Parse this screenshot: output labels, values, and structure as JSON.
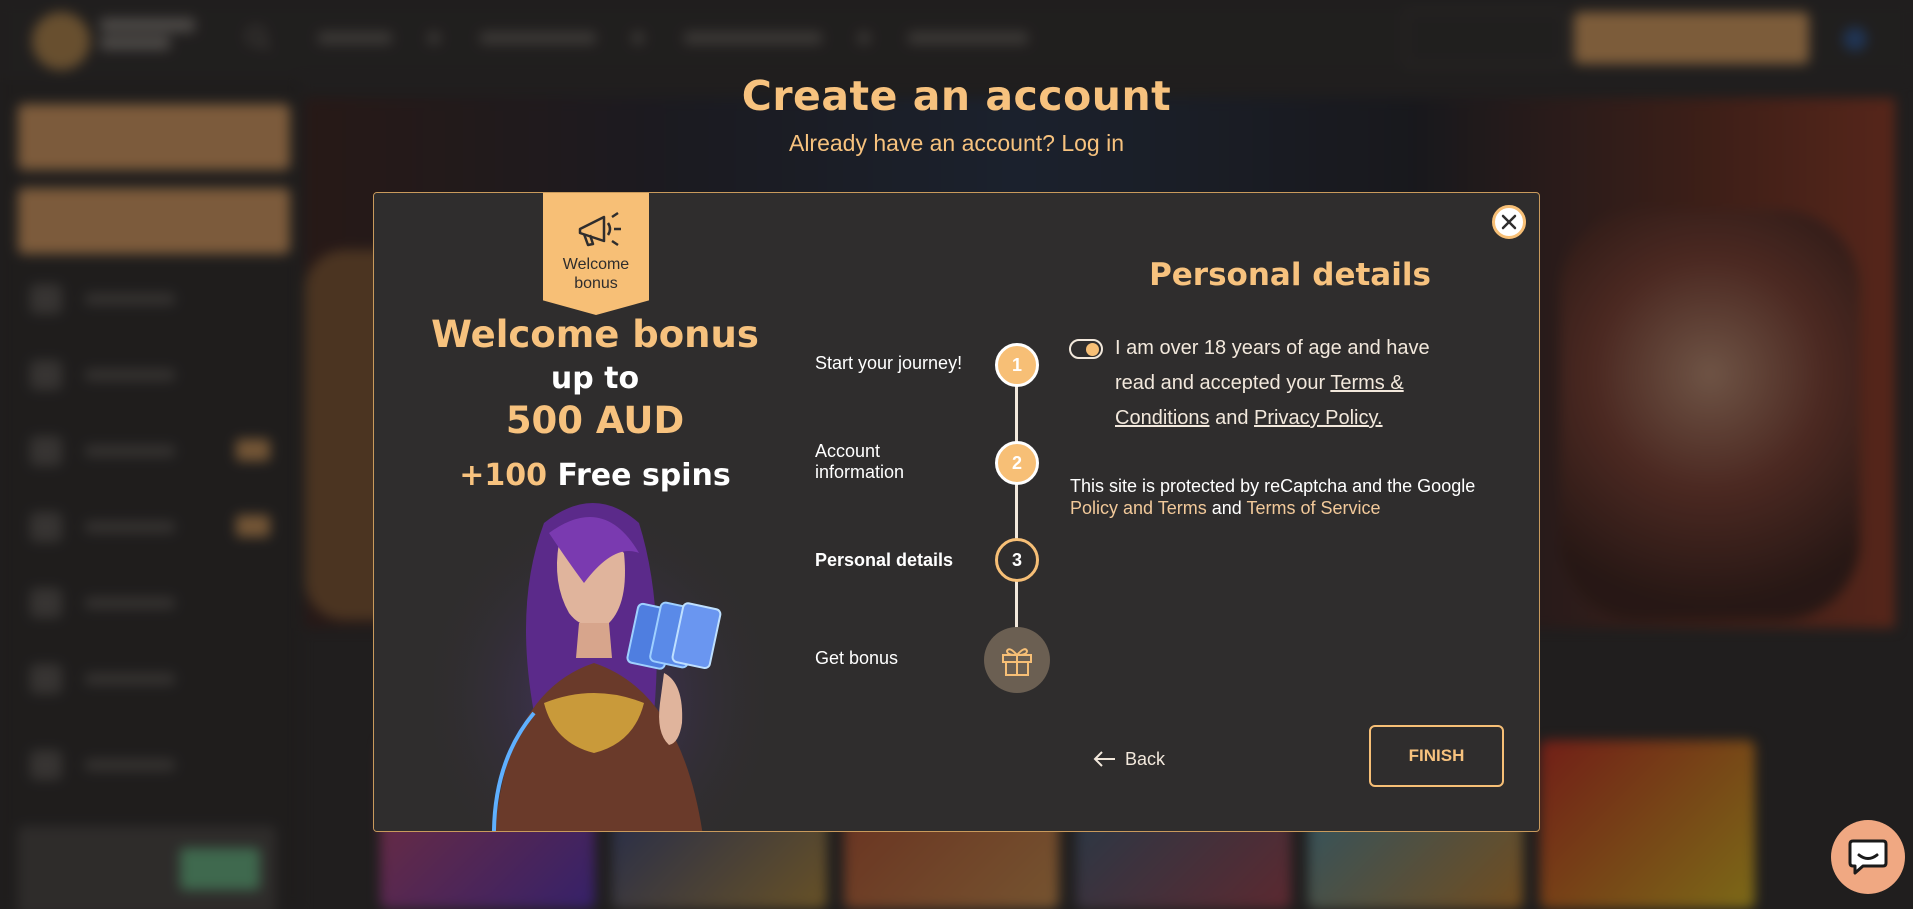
{
  "page": {
    "title": "Create an account",
    "subtitle": "Already have an account? Log in"
  },
  "background": {
    "header": {
      "search_icon": "search-icon",
      "login_label": "",
      "register_label": ""
    }
  },
  "modal": {
    "badge": {
      "icon": "megaphone-icon",
      "text": "Welcome bonus"
    },
    "bonus": {
      "title": "Welcome bonus",
      "up_to": "up to",
      "amount": "500 AUD",
      "spins_plus": "+100",
      "spins_text": "Free spins"
    },
    "steps": [
      {
        "label": "Start your journey!",
        "number": "1",
        "state": "done"
      },
      {
        "label": "Account information",
        "number": "2",
        "state": "done"
      },
      {
        "label": "Personal details",
        "number": "3",
        "state": "active"
      },
      {
        "label": "Get bonus",
        "icon": "gift-icon",
        "state": "pending"
      }
    ],
    "form": {
      "title": "Personal details",
      "consent_checked": true,
      "consent_text_1": "I am over 18 years of age and have read and accepted your",
      "terms_link": "Terms & Conditions",
      "consent_and": "and",
      "privacy_link": "Privacy Policy.",
      "recaptcha_text_1": "This site is protected by reCaptcha and the Google",
      "recaptcha_policy_link": "Policy and Terms",
      "recaptcha_and": "and",
      "recaptcha_tos_link": "Terms of Service",
      "back_label": "Back",
      "finish_label": "FINISH"
    },
    "close_icon": "close-icon"
  },
  "colors": {
    "accent": "#f7c27e",
    "accent_strong": "#f7bf76",
    "modal_bg": "#2f2d2d",
    "chat_bubble": "#f0a882"
  }
}
